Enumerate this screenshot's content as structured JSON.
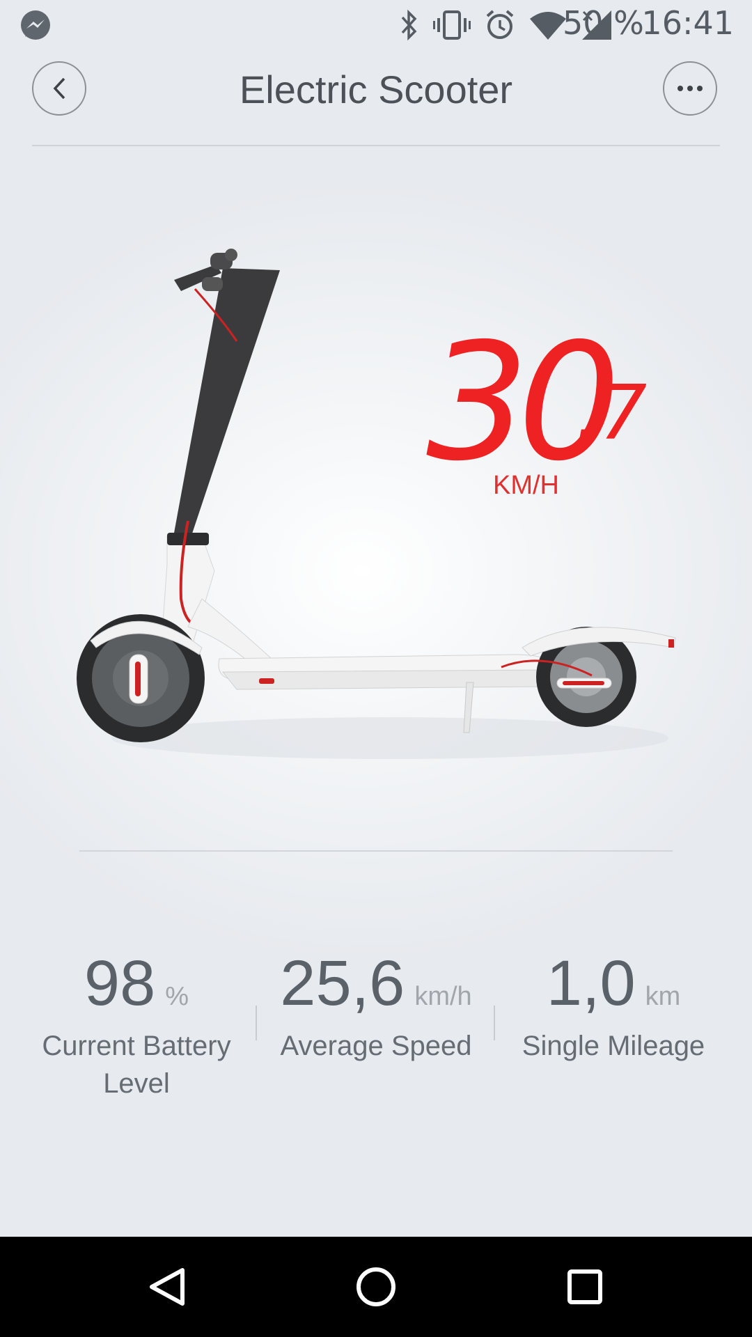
{
  "status_bar": {
    "battery": "50 %",
    "time": "16:41",
    "icons": [
      "messenger-icon",
      "bluetooth-icon",
      "vibrate-icon",
      "alarm-icon",
      "wifi-icon",
      "signal-icon"
    ]
  },
  "header": {
    "title": "Electric Scooter",
    "back_icon": "chevron-left-icon",
    "more_icon": "more-dots-icon"
  },
  "speed": {
    "integer": "30",
    "decimal": ".7",
    "unit": "KM/H",
    "color": "#ee2222"
  },
  "stats": [
    {
      "value": "98",
      "unit": "%",
      "label": "Current Battery Level"
    },
    {
      "value": "25,6",
      "unit": "km/h",
      "label": "Average Speed"
    },
    {
      "value": "1,0",
      "unit": "km",
      "label": "Single Mileage"
    }
  ],
  "nav_bar": {
    "icons": [
      "nav-back-icon",
      "nav-home-icon",
      "nav-recents-icon"
    ]
  }
}
